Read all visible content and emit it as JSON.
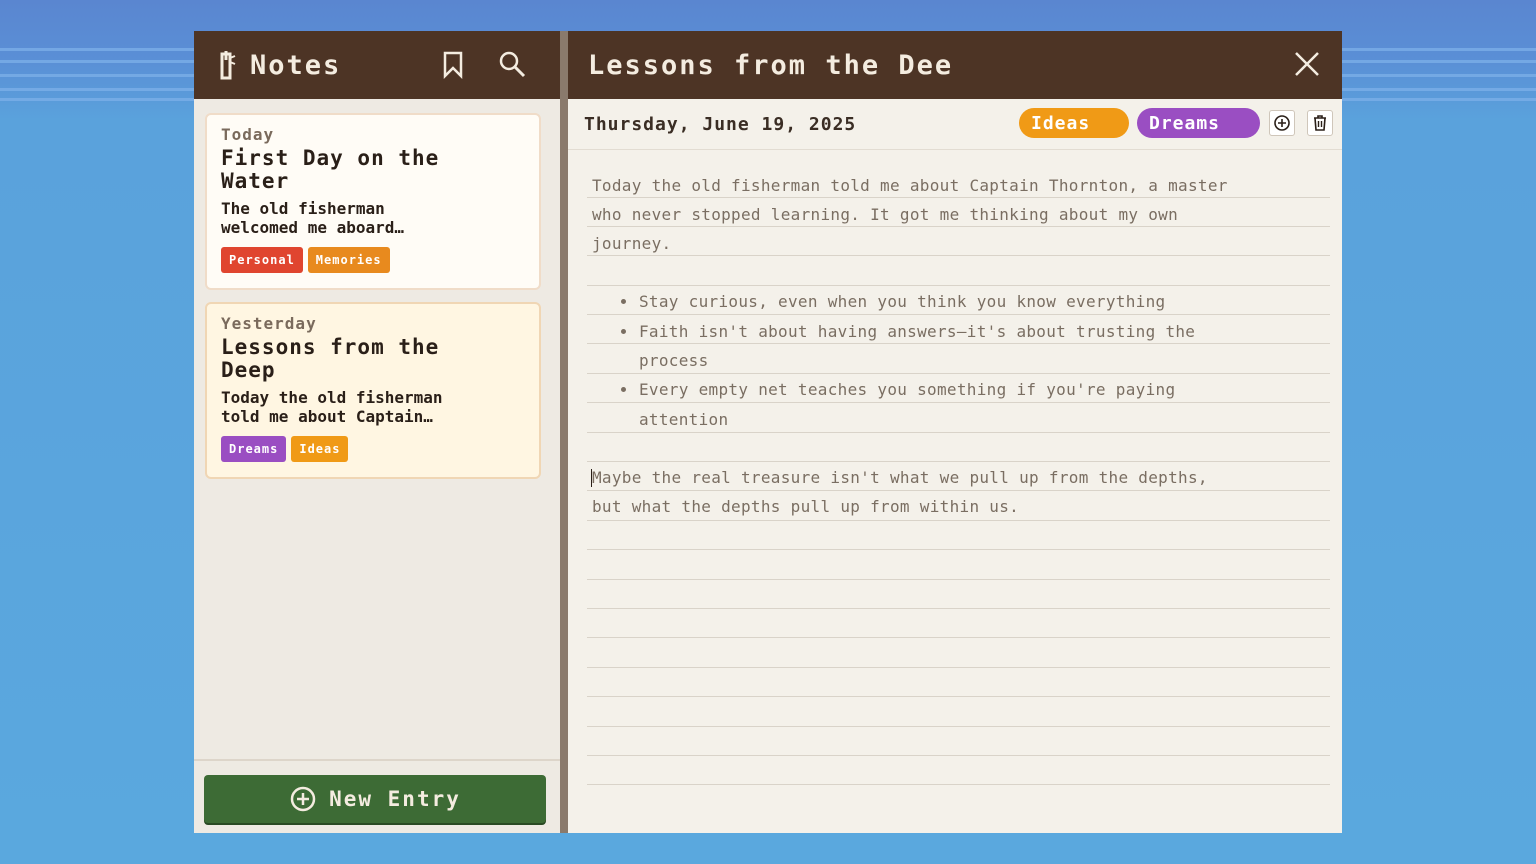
{
  "sidebar": {
    "title": "Notes",
    "icons": {
      "logo": "lighthouse-icon",
      "bookmark": "bookmark-icon",
      "search": "search-icon"
    },
    "entries": [
      {
        "when": "Today",
        "title_lines": [
          "First Day on the",
          "Water"
        ],
        "preview_lines": [
          "The old fisherman",
          "welcomed me aboard…"
        ],
        "tags": [
          {
            "label": "Personal",
            "color": "#e0452f"
          },
          {
            "label": "Memories",
            "color": "#e88a1e"
          }
        ]
      },
      {
        "when": "Yesterday",
        "title_lines": [
          "Lessons from the",
          "Deep"
        ],
        "preview_lines": [
          "Today the old fisherman",
          "told me about Captain…"
        ],
        "tags": [
          {
            "label": "Dreams",
            "color": "#9a4ec2"
          },
          {
            "label": "Ideas",
            "color": "#f09a16"
          }
        ]
      }
    ],
    "new_entry_label": "New Entry"
  },
  "editor": {
    "title": "Lessons from the Dee",
    "date": "Thursday, June 19, 2025",
    "tags": [
      {
        "label": "Ideas",
        "color": "#f09a16"
      },
      {
        "label": "Dreams",
        "color": "#9a4ec2"
      }
    ],
    "icons": {
      "add_tag": "plus-circle-icon",
      "delete": "trash-icon",
      "close": "close-icon"
    },
    "body": {
      "para1_lines": [
        "Today the old fisherman told me about Captain Thornton, a master",
        "who never stopped learning. It got me thinking about my own",
        "journey."
      ],
      "bullets": [
        [
          "Stay curious, even when you think you know everything"
        ],
        [
          "Faith isn't about having answers—it's about trusting the",
          "process"
        ],
        [
          "Every empty net teaches you something if you're paying",
          "attention"
        ]
      ],
      "para2_lines": [
        "Maybe the real treasure isn't what we pull up from the depths,",
        "but what the depths pull up from within us."
      ]
    }
  }
}
